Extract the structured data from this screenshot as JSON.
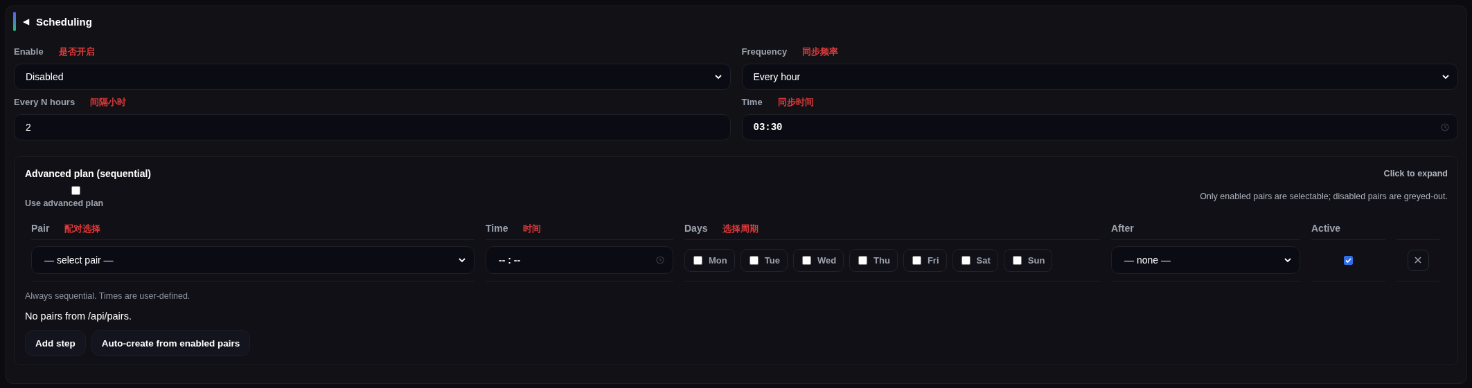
{
  "section": {
    "toggle": "◀",
    "title": "Scheduling"
  },
  "fields": [
    {
      "label": "Enable",
      "annotation": "是否开启",
      "kind": "select",
      "value": "Disabled"
    },
    {
      "label": "Frequency",
      "annotation": "同步频率",
      "kind": "select",
      "value": "Every hour"
    },
    {
      "label": "Every N hours",
      "annotation": "间隔小时",
      "kind": "number",
      "value": "2"
    },
    {
      "label": "Time",
      "annotation": "同步时间",
      "kind": "time",
      "value": "03:30"
    }
  ],
  "advanced_plan": {
    "title": "Advanced plan (sequential)",
    "expand_hint": "Click to expand",
    "use_advanced": {
      "label": "Use advanced plan",
      "checked": false
    },
    "note": "Only enabled pairs are selectable; disabled pairs are greyed-out.",
    "columns": [
      {
        "label": "Pair",
        "annotation": "配对选择"
      },
      {
        "label": "Time",
        "annotation": "时间"
      },
      {
        "label": "Days",
        "annotation": "选择周期"
      },
      {
        "label": "After"
      },
      {
        "label": "Active"
      }
    ],
    "rows": [
      {
        "pair": "— select pair —",
        "time": "-- : --",
        "days": [
          {
            "label": "Mon",
            "checked": false
          },
          {
            "label": "Tue",
            "checked": false
          },
          {
            "label": "Wed",
            "checked": false
          },
          {
            "label": "Thu",
            "checked": false
          },
          {
            "label": "Fri",
            "checked": false
          },
          {
            "label": "Sat",
            "checked": false
          },
          {
            "label": "Sun",
            "checked": false
          }
        ],
        "after": "— none —",
        "active": true
      }
    ],
    "footnote": "Always sequential. Times are user-defined.",
    "empty_message": "No pairs from /api/pairs.",
    "buttons": [
      "Add step",
      "Auto-create from enabled pairs"
    ]
  }
}
